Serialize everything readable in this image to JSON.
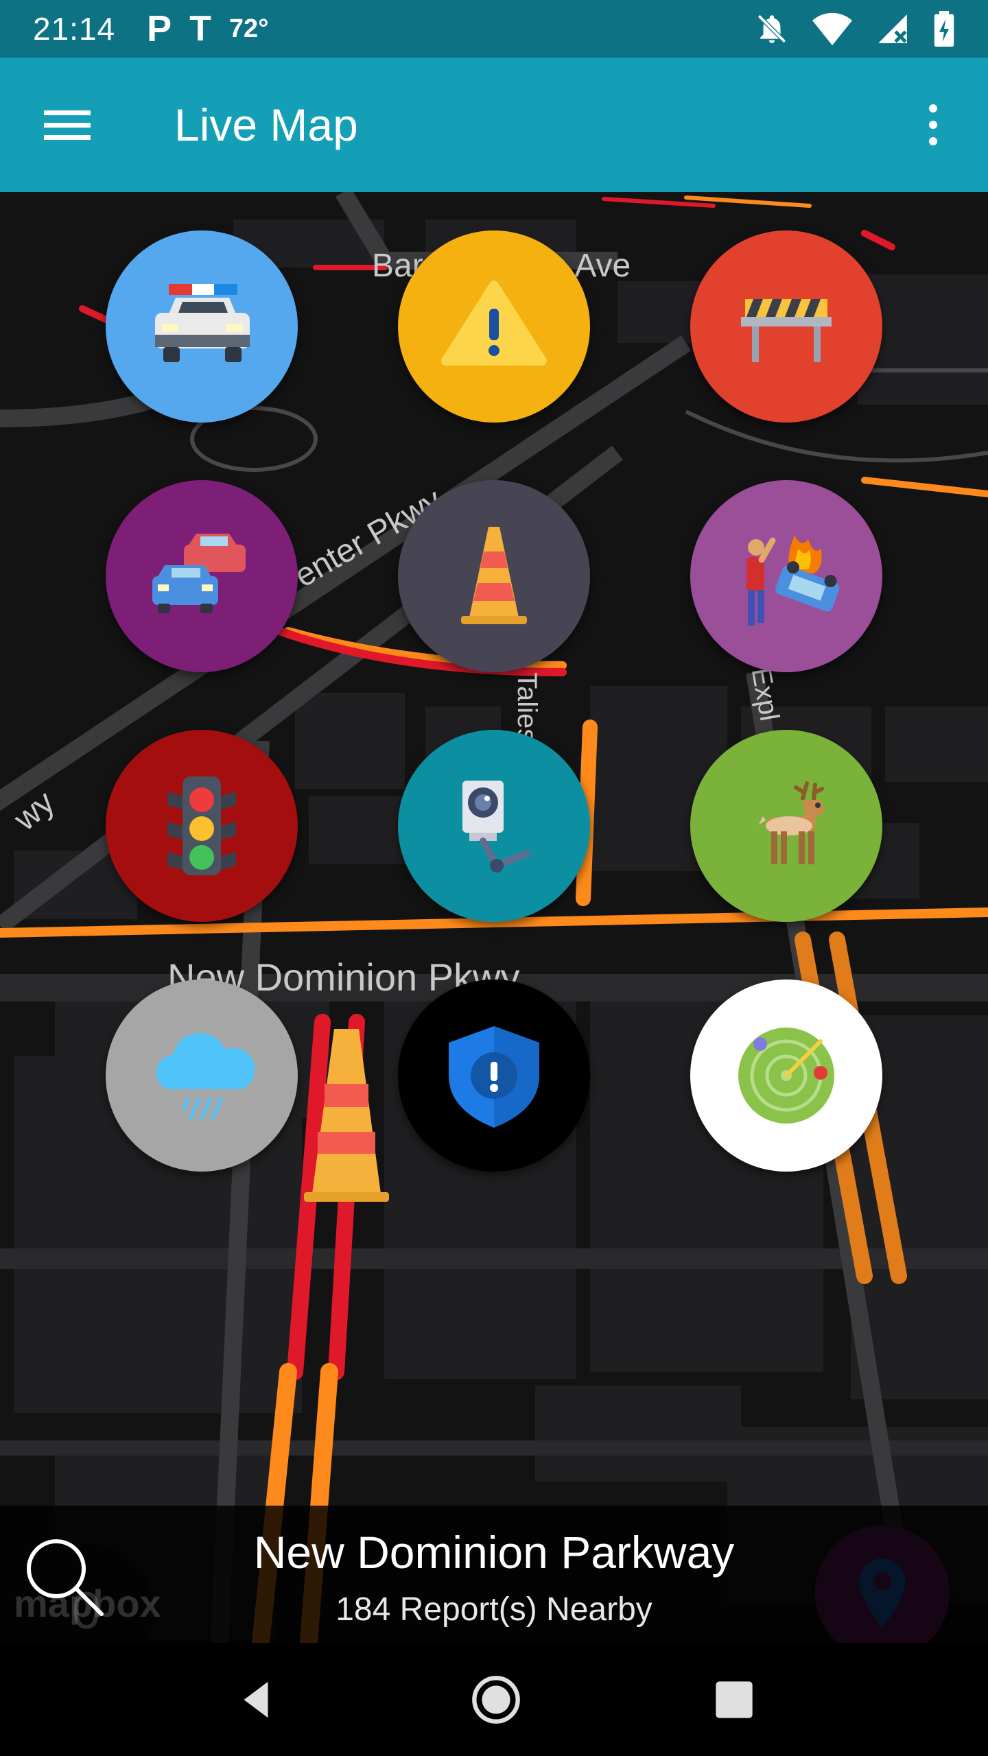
{
  "status_bar": {
    "time": "21:14",
    "carrier_icon": "p-icon",
    "network_icon": "t-mobile-icon",
    "temperature": "72°",
    "right_icons": [
      "mute-icon",
      "wifi-icon",
      "signal-icon",
      "battery-charging-icon"
    ]
  },
  "app_bar": {
    "title": "Live Map",
    "menu_icon": "hamburger-menu-icon",
    "overflow_icon": "more-vert-icon",
    "color": "#149fb6"
  },
  "map": {
    "road_labels": [
      "Bar",
      "n Ave",
      "enter Pkwy",
      "Taliesi",
      "Expl",
      "wy",
      "New Dominion Pkwy"
    ]
  },
  "reports": [
    {
      "name": "police",
      "icon": "police-car-icon",
      "color": "#55a8ee"
    },
    {
      "name": "hazard",
      "icon": "warning-icon",
      "color": "#f4b10f"
    },
    {
      "name": "road-closure",
      "icon": "barrier-icon",
      "color": "#e2412e"
    },
    {
      "name": "traffic",
      "icon": "traffic-cars-icon",
      "color": "#7d1f77"
    },
    {
      "name": "construction",
      "icon": "traffic-cone-icon",
      "color": "#474553"
    },
    {
      "name": "accident",
      "icon": "car-crash-icon",
      "color": "#9b4f98"
    },
    {
      "name": "traffic-light",
      "icon": "traffic-light-icon",
      "color": "#a50e0e"
    },
    {
      "name": "camera",
      "icon": "camera-icon",
      "color": "#0c8fa1"
    },
    {
      "name": "animal",
      "icon": "deer-icon",
      "color": "#7bb23a"
    },
    {
      "name": "weather",
      "icon": "rain-cloud-icon",
      "color": "#a6a6a6"
    },
    {
      "name": "security",
      "icon": "shield-alert-icon",
      "color": "#000000"
    },
    {
      "name": "radar",
      "icon": "radar-icon",
      "color": "#ffffff"
    }
  ],
  "count": "0",
  "bottom": {
    "title": "New Dominion Parkway",
    "subtitle": "184 Report(s) Nearby",
    "watermark": "mapbox"
  },
  "nav": [
    "back-icon",
    "home-icon",
    "recents-icon"
  ]
}
